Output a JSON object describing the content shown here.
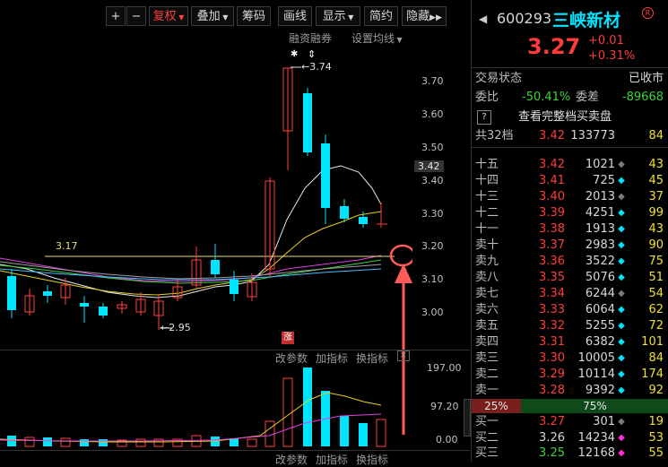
{
  "toolbar": {
    "plus": "+",
    "minus": "−",
    "fuquan": "复权",
    "diejia": "叠加",
    "chouma": "筹码",
    "huaxian": "画线",
    "xianshi": "显示",
    "jianyue": "简约",
    "yincang": "隐藏",
    "more": "▶▶",
    "rongzi": "融资融券",
    "shezhi": "设置均线"
  },
  "price_axis": [
    "3.70",
    "3.60",
    "3.50",
    "3.42",
    "3.40",
    "3.30",
    "3.20",
    "3.10",
    "3.00"
  ],
  "annotations": {
    "high": "3.74",
    "low": "2.95",
    "line_level": "3.17",
    "limit_up": "涨",
    "asterisk": "✱",
    "arrows": "⇕"
  },
  "indicator_bar": {
    "gaican": "改参数",
    "jiazhi": "加指标",
    "huanzhi": "换指标",
    "close": "✕"
  },
  "volume_axis": [
    "197.00",
    "97.20",
    "0.00"
  ],
  "header": {
    "code": "600293",
    "name": "三峡新材",
    "price": "3.27",
    "change": "+0.01",
    "change_pct": "+0.31%",
    "status_label": "交易状态",
    "status_value": "已收市",
    "weibi_label": "委比",
    "weibi_value": "-50.41%",
    "weicha_label": "委差",
    "weicha_value": "-89668",
    "help": "?",
    "full_book": "查看完整档买卖盘",
    "total_label": "共32档",
    "total_price": "3.42",
    "total_vol": "133773",
    "total_count": "84"
  },
  "asks": [
    {
      "label": "十五",
      "price": "3.42",
      "vol": "1021",
      "count": "43"
    },
    {
      "label": "十四",
      "price": "3.41",
      "vol": "725",
      "count": "45"
    },
    {
      "label": "十三",
      "price": "3.40",
      "vol": "2013",
      "count": "37"
    },
    {
      "label": "十二",
      "price": "3.39",
      "vol": "4251",
      "count": "99"
    },
    {
      "label": "十一",
      "price": "3.38",
      "vol": "1913",
      "count": "43"
    },
    {
      "label": "卖十",
      "price": "3.37",
      "vol": "2983",
      "count": "90"
    },
    {
      "label": "卖九",
      "price": "3.36",
      "vol": "3522",
      "count": "75"
    },
    {
      "label": "卖八",
      "price": "3.35",
      "vol": "5076",
      "count": "51"
    },
    {
      "label": "卖七",
      "price": "3.34",
      "vol": "6244",
      "count": "54"
    },
    {
      "label": "卖六",
      "price": "3.33",
      "vol": "6064",
      "count": "62"
    },
    {
      "label": "卖五",
      "price": "3.32",
      "vol": "5255",
      "count": "72"
    },
    {
      "label": "卖四",
      "price": "3.31",
      "vol": "6382",
      "count": "101"
    },
    {
      "label": "卖三",
      "price": "3.30",
      "vol": "10005",
      "count": "84"
    },
    {
      "label": "卖二",
      "price": "3.29",
      "vol": "10114",
      "count": "174"
    },
    {
      "label": "卖一",
      "price": "3.28",
      "vol": "9392",
      "count": "92"
    }
  ],
  "ratio": {
    "left": "25%",
    "right": "75%"
  },
  "bids": [
    {
      "label": "买一",
      "price": "3.27",
      "vol": "301",
      "count": "19"
    },
    {
      "label": "买二",
      "price": "3.26",
      "vol": "14234",
      "count": "53"
    },
    {
      "label": "买三",
      "price": "3.25",
      "vol": "12168",
      "count": "55"
    }
  ]
}
